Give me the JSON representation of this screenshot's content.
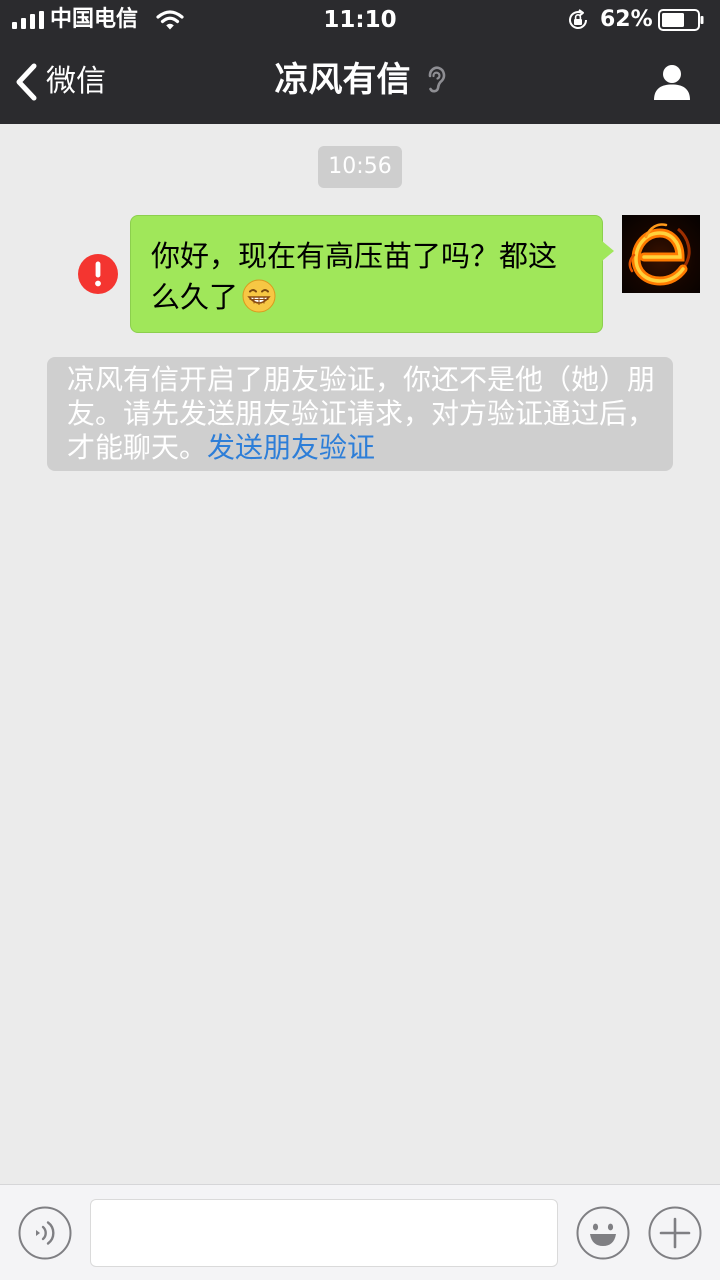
{
  "status_bar": {
    "carrier": "中国电信",
    "time": "11:10",
    "battery": "62%"
  },
  "nav": {
    "back_label": "微信",
    "title": "凉风有信"
  },
  "chat": {
    "timestamp": "10:56",
    "outgoing_message": "你好，现在有高压苗了吗？都这么久了",
    "system_message_text": "凉风有信开启了朋友验证，你还不是他（她）朋友。请先发送朋友验证请求，对方验证通过后，才能聊天。",
    "system_message_link": "发送朋友验证"
  },
  "input": {
    "value": ""
  },
  "colors": {
    "header_bg": "#2b2b2e",
    "chat_bg": "#ebebeb",
    "bubble_green": "#a0e75a",
    "error_red": "#f43530",
    "link_blue": "#2d7ed8",
    "system_bg": "#cfcfcf"
  },
  "icons": {
    "signal": "signal-icon",
    "wifi": "wifi-icon",
    "lock": "orientation-lock-icon",
    "battery": "battery-icon",
    "back": "chevron-left-icon",
    "ear": "ear-icon",
    "profile": "person-icon",
    "error": "exclamation-icon",
    "voice": "voice-icon",
    "emoji": "smiley-icon",
    "plus": "plus-icon"
  }
}
